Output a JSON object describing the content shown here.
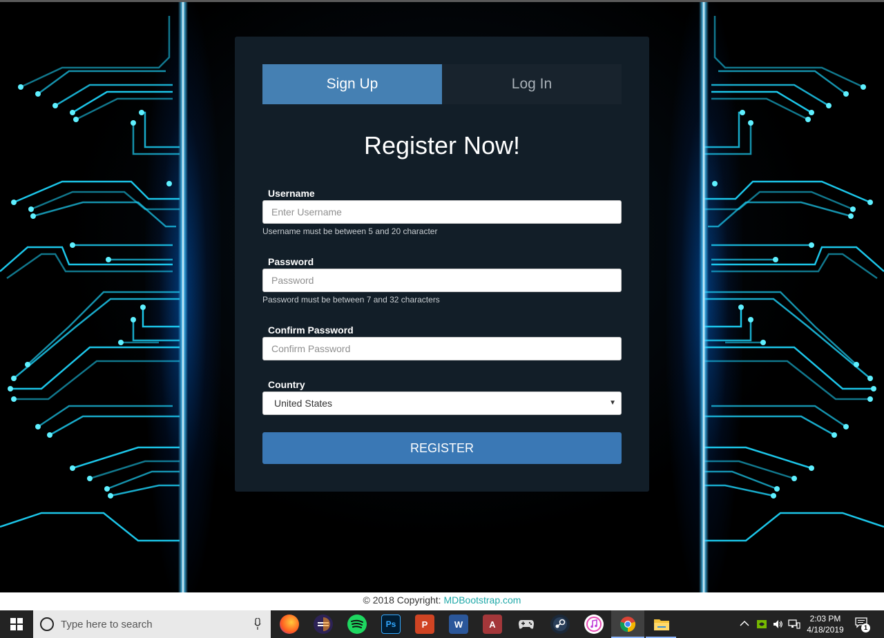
{
  "tabs": {
    "signup_label": "Sign Up",
    "login_label": "Log In"
  },
  "form": {
    "title": "Register Now!",
    "username": {
      "label": "Username",
      "placeholder": "Enter Username",
      "hint": "Username must be between 5 and 20 character"
    },
    "password": {
      "label": "Password",
      "placeholder": "Password",
      "hint": "Password must be between 7 and 32 characters"
    },
    "confirm_password": {
      "label": "Confirm Password",
      "placeholder": "Confirm Password"
    },
    "country": {
      "label": "Country",
      "selected": "United States"
    },
    "register_label": "REGISTER"
  },
  "footer": {
    "copyright": "© 2018 Copyright: ",
    "link_text": "MDBootstrap.com"
  },
  "taskbar": {
    "search_placeholder": "Type here to search",
    "apps": [
      "firefox-icon",
      "eclipse-icon",
      "spotify-icon",
      "photoshop-icon",
      "powerpoint-icon",
      "word-icon",
      "access-icon",
      "gamepad-icon",
      "steam-icon",
      "itunes-icon",
      "chrome-icon",
      "file-explorer-icon"
    ],
    "time": "2:03 PM",
    "date": "4/18/2019",
    "notification_count": "1"
  },
  "colors": {
    "card_bg": "#121e28",
    "tab_active": "#4580b3",
    "button": "#3a78b5",
    "circuit": "#1fd8ff"
  }
}
